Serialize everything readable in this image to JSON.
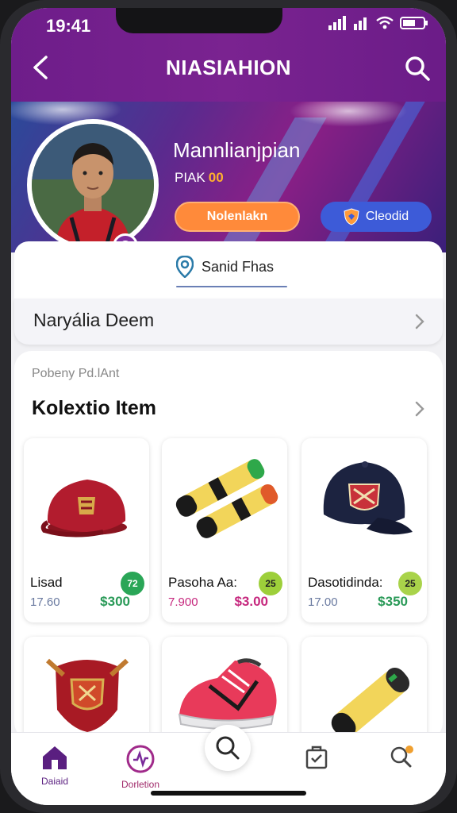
{
  "status": {
    "time": "19:41"
  },
  "header": {
    "title": "NIASIAHION"
  },
  "profile": {
    "name": "Mannlianjpian",
    "rank_label": "PIAK",
    "rank_value": "00",
    "primary_button": "Nolenlakn",
    "secondary_button": "Cleodid"
  },
  "location": {
    "text": "Sanid Fhas"
  },
  "row": {
    "label": "Naryália Deem"
  },
  "collection": {
    "subtitle": "Pobeny Pd.lAnt",
    "title": "Kolextio Item",
    "items": [
      {
        "name": "Lisad",
        "price_old": "17.60",
        "price": "$300",
        "tag": "72",
        "tag_color": "#2aa657",
        "price_color": "#2a9a58",
        "icon": "red-cap-icon"
      },
      {
        "name": "Pasoha Aa:",
        "price_old": "7.900",
        "price": "$3.00",
        "tag": "25",
        "tag_color": "#9dcf3a",
        "price_color": "#c6287e",
        "icon": "wrist-bands-icon"
      },
      {
        "name": "Dasotidinda:",
        "price_old": "17.00",
        "price": "$350",
        "tag": "25",
        "tag_color": "#a9d34a",
        "price_color": "#2a9a58",
        "icon": "navy-cap-icon"
      },
      {
        "name": "",
        "price_old": "",
        "price": "",
        "tag": "",
        "tag_color": "#ffffff",
        "price_color": "#000000",
        "icon": "shield-badge-icon"
      },
      {
        "name": "",
        "price_old": "",
        "price": "",
        "tag": "",
        "tag_color": "#ffffff",
        "price_color": "#000000",
        "icon": "sneaker-icon"
      },
      {
        "name": "",
        "price_old": "",
        "price": "",
        "tag": "",
        "tag_color": "#ffffff",
        "price_color": "#000000",
        "icon": "wrist-band-icon"
      }
    ]
  },
  "nav": {
    "items": [
      {
        "label": "Daiaid",
        "icon": "home-icon"
      },
      {
        "label": "Dorletion",
        "icon": "activity-icon"
      },
      {
        "label": "",
        "icon": "search-icon"
      },
      {
        "label": "",
        "icon": "clipboard-icon"
      },
      {
        "label": "",
        "icon": "search-alert-icon"
      }
    ]
  },
  "colors": {
    "brand": "#6e1d8a",
    "accent_orange": "#ff8a3a",
    "accent_blue": "#3d5bd8"
  }
}
